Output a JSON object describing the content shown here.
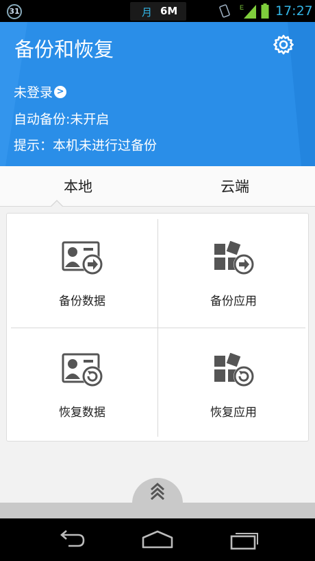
{
  "status_bar": {
    "calendar_day": "31",
    "month": "月",
    "speed": "6M",
    "network_type": "E",
    "time": "17:27"
  },
  "header": {
    "title": "备份和恢复",
    "login_text": "未登录",
    "auto_backup": "自动备份:未开启",
    "tip": "提示：本机未进行过备份"
  },
  "tabs": {
    "local": "本地",
    "cloud": "云端"
  },
  "grid": {
    "backup_data": "备份数据",
    "backup_apps": "备份应用",
    "restore_data": "恢复数据",
    "restore_apps": "恢复应用"
  },
  "colors": {
    "header_bg": "#2a8ee8",
    "status_accent": "#33b5e5"
  }
}
